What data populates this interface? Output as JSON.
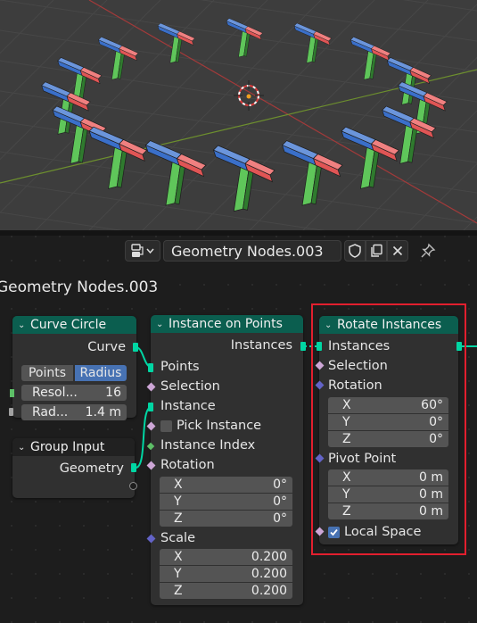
{
  "header": {
    "editor_type_icon": "node-editor-icon",
    "tree_name": "Geometry Nodes.003",
    "icons": [
      "shield-icon",
      "duplicate-icon",
      "close-icon",
      "pin-icon"
    ]
  },
  "tree_title": "Geometry Nodes.003",
  "colors": {
    "geometry_header": "#0b5e4f",
    "highlight": "#e21f2e",
    "link": "#00d6a3",
    "active_button": "#4772b3"
  },
  "nodes": {
    "curve_circle": {
      "title": "Curve Circle",
      "output": "Curve",
      "modes": [
        "Points",
        "Radius"
      ],
      "active_mode": "Radius",
      "fields": [
        {
          "label": "Resol...",
          "value": "16"
        },
        {
          "label": "Rad...",
          "value": "1.4 m"
        }
      ]
    },
    "group_input": {
      "title": "Group Input",
      "output": "Geometry"
    },
    "instance_on_points": {
      "title": "Instance on Points",
      "output": "Instances",
      "inputs": {
        "points": "Points",
        "selection": "Selection",
        "instance": "Instance",
        "pick_instance": "Pick Instance",
        "instance_index": "Instance Index",
        "rotation": "Rotation",
        "scale": "Scale"
      },
      "rotation": [
        {
          "axis": "X",
          "value": "0°"
        },
        {
          "axis": "Y",
          "value": "0°"
        },
        {
          "axis": "Z",
          "value": "0°"
        }
      ],
      "scale": [
        {
          "axis": "X",
          "value": "0.200"
        },
        {
          "axis": "Y",
          "value": "0.200"
        },
        {
          "axis": "Z",
          "value": "0.200"
        }
      ]
    },
    "rotate_instances": {
      "title": "Rotate Instances",
      "output": "Instances",
      "inputs": {
        "instances": "Instances",
        "selection": "Selection",
        "rotation": "Rotation",
        "pivot_point": "Pivot Point",
        "local_space": "Local Space"
      },
      "rotation": [
        {
          "axis": "X",
          "value": "60°"
        },
        {
          "axis": "Y",
          "value": "0°"
        },
        {
          "axis": "Z",
          "value": "0°"
        }
      ],
      "pivot": [
        {
          "axis": "X",
          "value": "0 m"
        },
        {
          "axis": "Y",
          "value": "0 m"
        },
        {
          "axis": "Z",
          "value": "0 m"
        }
      ],
      "local_space_checked": true
    }
  }
}
